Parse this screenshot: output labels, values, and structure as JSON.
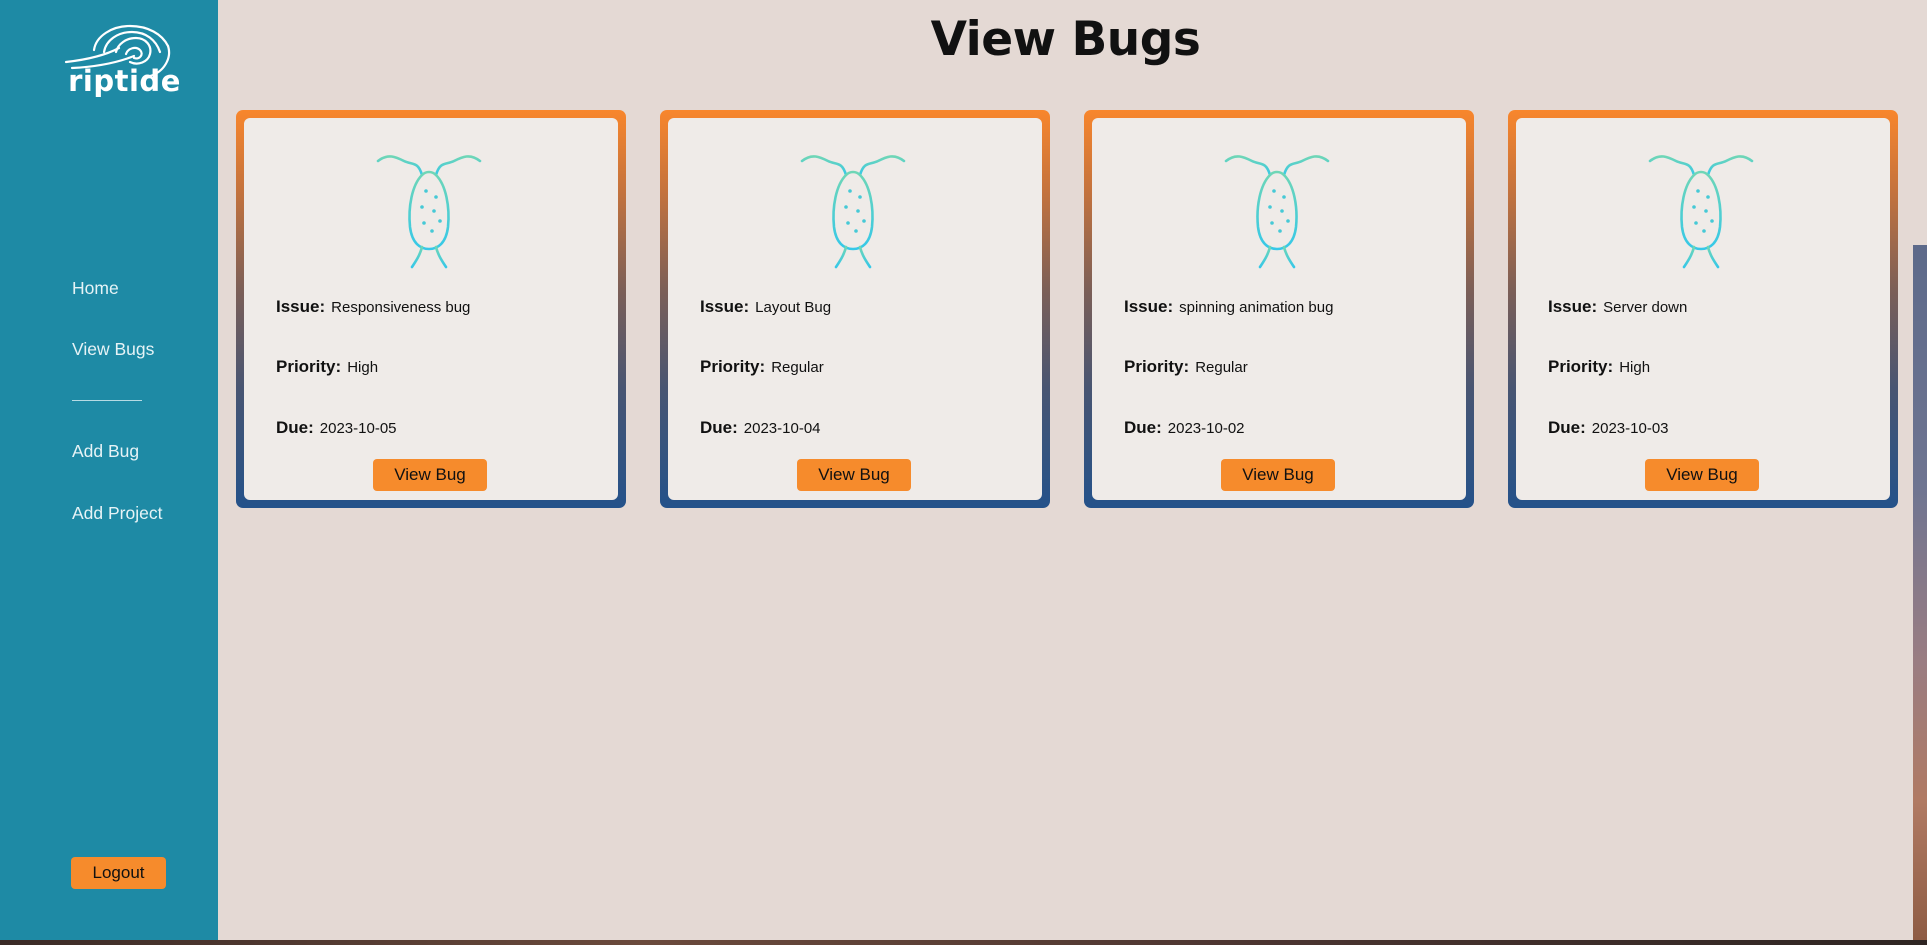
{
  "app": {
    "logo_text": "riptide"
  },
  "sidebar": {
    "nav": [
      {
        "label": "Home"
      },
      {
        "label": "View Bugs"
      },
      {
        "label": "Add Bug"
      },
      {
        "label": "Add Project"
      }
    ],
    "logout_label": "Logout"
  },
  "main": {
    "title": "View Bugs",
    "field_labels": {
      "issue": "Issue:",
      "priority": "Priority:",
      "due": "Due:"
    },
    "cards": [
      {
        "issue": "Responsiveness bug",
        "priority": "High",
        "due": "2023-10-05",
        "button": "View Bug"
      },
      {
        "issue": "Layout Bug",
        "priority": "Regular",
        "due": "2023-10-04",
        "button": "View Bug"
      },
      {
        "issue": "spinning animation bug",
        "priority": "Regular",
        "due": "2023-10-02",
        "button": "View Bug"
      },
      {
        "issue": "Server down",
        "priority": "High",
        "due": "2023-10-03",
        "button": "View Bug"
      }
    ]
  },
  "colors": {
    "sidebar": "#1e8aa5",
    "page_background": "#e4d9d4",
    "accent_orange": "#f68b2c",
    "card_gradient_top": "#f8862c",
    "card_gradient_bottom": "#24528a",
    "bug_icon_top": "#6fd6b6",
    "bug_icon_bottom": "#36c8e8"
  },
  "icons": {
    "logo": "wave-icon",
    "card_image": "bug-icon"
  }
}
